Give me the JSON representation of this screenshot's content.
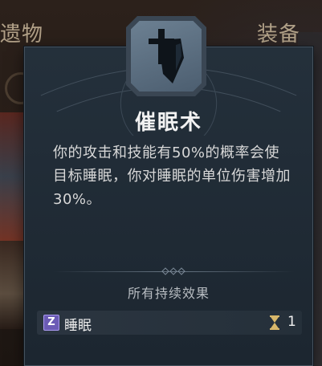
{
  "background": {
    "tab_left": "遗物",
    "tab_right": "装备"
  },
  "tooltip": {
    "skill_icon": "shield-dagger-icon",
    "title": "催眠术",
    "description": "你的攻击和技能有50%的概率会使目标睡眠，你对睡眠的单位伤害增加30%。",
    "effects_header": "所有持续效果",
    "effects": [
      {
        "icon": "sleep-z-icon",
        "icon_glyph": "Z",
        "name": "睡眠",
        "duration_icon": "hourglass-icon",
        "duration": "1"
      }
    ]
  },
  "colors": {
    "panel_bg": "#1c2630",
    "panel_border": "#45525e",
    "title_text": "#f2f2f2",
    "body_text": "#d8d8d8",
    "sleep_effect": "#6b5bb5",
    "hourglass": "#d8b76a"
  }
}
